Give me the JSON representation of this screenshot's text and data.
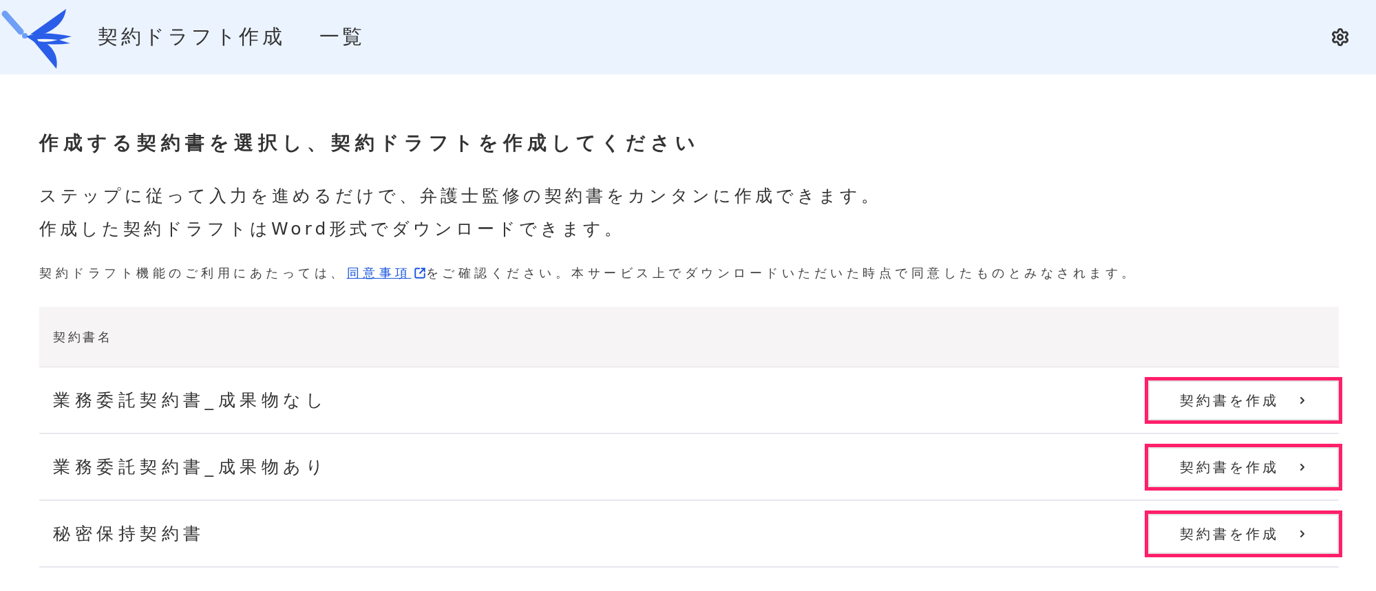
{
  "header": {
    "title": "契約ドラフト作成",
    "subtitle": "一覧"
  },
  "heading": "作成する契約書を選択し、契約ドラフトを作成してください",
  "description": [
    "ステップに従って入力を進めるだけで、弁護士監修の契約書をカンタンに作成できます。",
    "作成した契約ドラフトはWord形式でダウンロードできます。"
  ],
  "notice": {
    "before": "契約ドラフト機能のご利用にあたっては、",
    "link": "同意事項",
    "after": "をご確認ください。本サービス上でダウンロードいただいた時点で同意したものとみなされます。"
  },
  "table": {
    "columns": [
      "契約書名"
    ],
    "rows": [
      {
        "name": "業務委託契約書_成果物なし",
        "button": "契約書を作成"
      },
      {
        "name": "業務委託契約書_成果物あり",
        "button": "契約書を作成"
      },
      {
        "name": "秘密保持契約書",
        "button": "契約書を作成"
      }
    ]
  }
}
